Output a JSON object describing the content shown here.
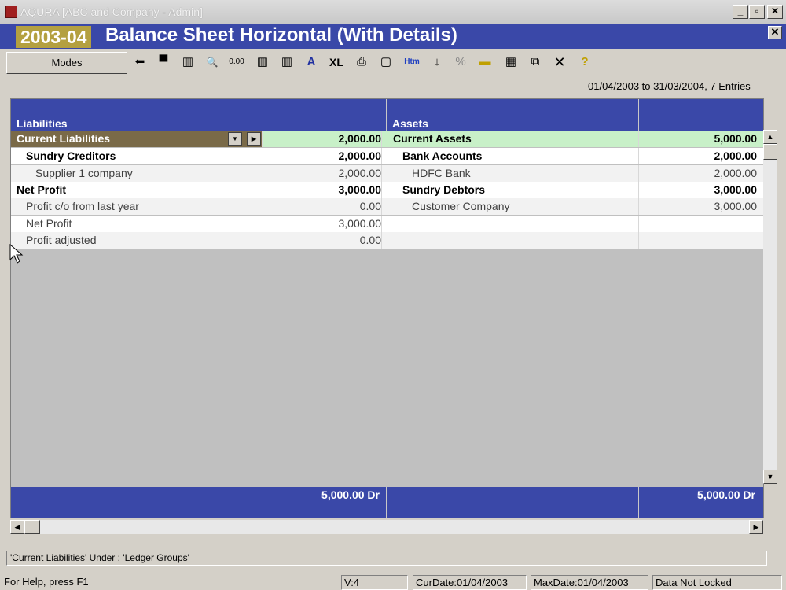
{
  "window": {
    "title": "AQURA [ABC and Company - Admin]",
    "min_label": "_",
    "max_label": "▫",
    "close_label": "✕"
  },
  "header": {
    "year": "2003-04",
    "title": "Balance Sheet Horizontal (With Details)",
    "close_label": "✕"
  },
  "toolbar": {
    "modes_label": "Modes",
    "icons": [
      "back-arrow-icon",
      "save-icon",
      "columns-icon",
      "find-icon",
      "zero-decimal-icon",
      "column-insert-icon",
      "column-remove-icon",
      "font-icon",
      "excel-icon",
      "print-icon",
      "page-setup-icon",
      "html-icon",
      "sort-icon",
      "percent-icon",
      "add-row-icon",
      "calculator-icon",
      "copy-icon",
      "close-icon",
      "help-icon"
    ],
    "icon_glyphs": [
      "⬅",
      "▀",
      "▥",
      "🔍",
      "0.00",
      "▥",
      "▥",
      "A",
      "XL",
      "⎙",
      "▢",
      "Htm",
      "↓",
      "%",
      "▬",
      "▦",
      "⧉",
      "✕",
      "?"
    ]
  },
  "range_text": "01/04/2003 to 31/03/2004, 7 Entries",
  "grid": {
    "left_header": "Liabilities",
    "right_header": "Assets",
    "rows": [
      {
        "l_name": "Current Liabilities",
        "l_amount": "2,000.00",
        "r_name": "Current Assets",
        "r_amount": "5,000.00"
      },
      {
        "l_name": "Sundry Creditors",
        "l_amount": "2,000.00",
        "r_name": "Bank Accounts",
        "r_amount": "2,000.00"
      },
      {
        "l_name": "Supplier 1 company",
        "l_amount": "2,000.00",
        "r_name": "HDFC Bank",
        "r_amount": "2,000.00"
      },
      {
        "l_name": "Net Profit",
        "l_amount": "3,000.00",
        "r_name": "Sundry Debtors",
        "r_amount": "3,000.00"
      },
      {
        "l_name": "Profit c/o from last year",
        "l_amount": "0.00",
        "r_name": "Customer Company",
        "r_amount": "3,000.00"
      },
      {
        "l_name": "Net Profit",
        "l_amount": "3,000.00",
        "r_name": "",
        "r_amount": ""
      },
      {
        "l_name": "Profit adjusted",
        "l_amount": "0.00",
        "r_name": "",
        "r_amount": ""
      }
    ],
    "left_total": "5,000.00 Dr",
    "right_total": "5,000.00 Dr"
  },
  "help_text": "'Current Liabilities' Under : 'Ledger Groups'",
  "status": {
    "help": "For Help, press F1",
    "version": "V:4",
    "curdate": "CurDate:01/04/2003",
    "maxdate": "MaxDate:01/04/2003",
    "lock": "Data Not Locked"
  },
  "colors": {
    "header_blue": "#3a48a8",
    "highlight": "#c8f0c8",
    "badge": "#b4a040",
    "selected": "#7a6a48"
  }
}
